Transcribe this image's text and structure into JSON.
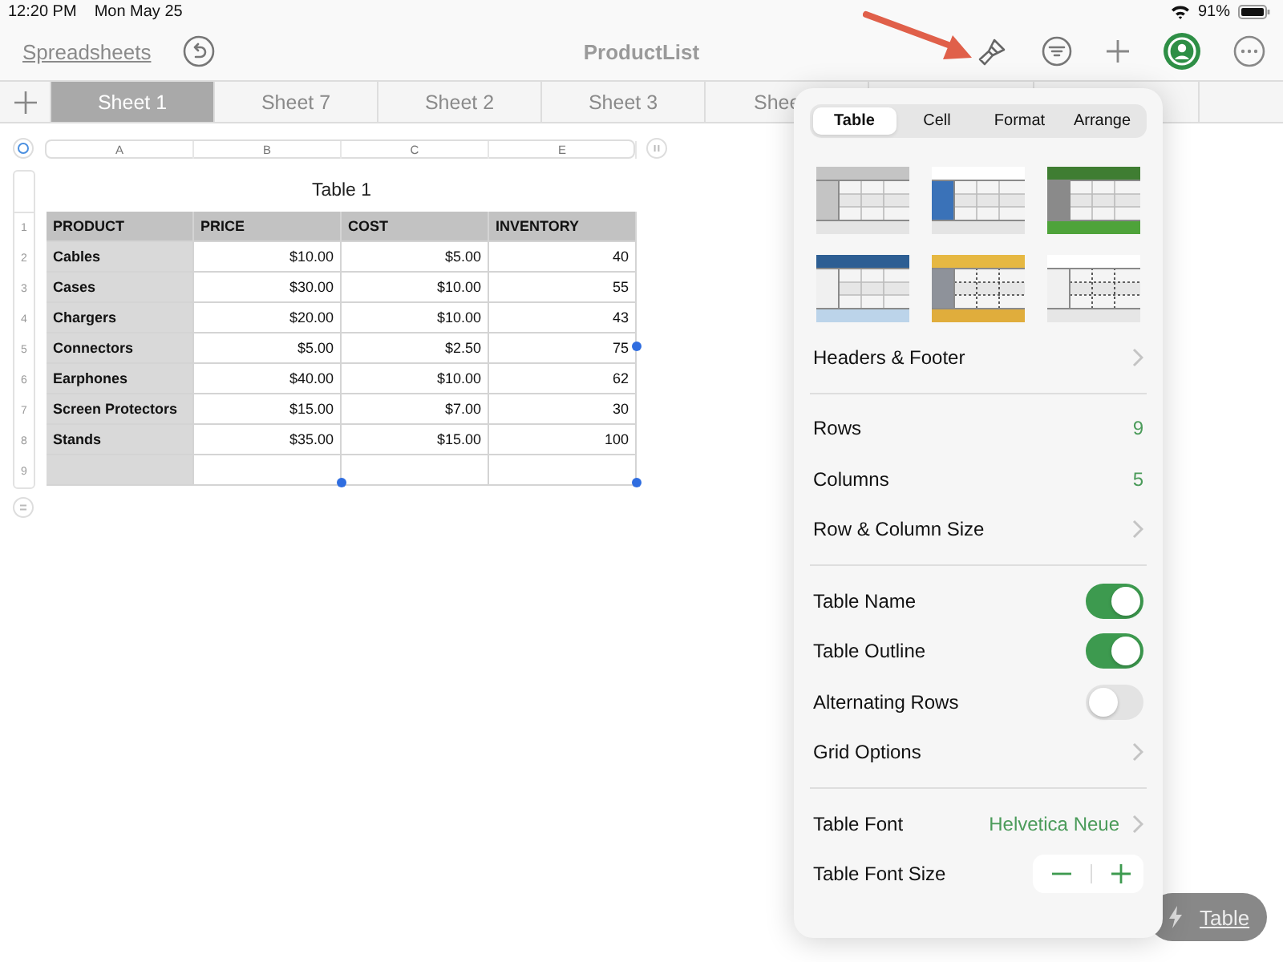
{
  "status_bar": {
    "time": "12:20 PM",
    "date": "Mon May 25",
    "battery": "91%"
  },
  "toolbar": {
    "back_link": "Spreadsheets",
    "title": "ProductList"
  },
  "sheet_tabs": [
    {
      "label": "Sheet 1",
      "selected": true
    },
    {
      "label": "Sheet 7",
      "selected": false
    },
    {
      "label": "Sheet 2",
      "selected": false
    },
    {
      "label": "Sheet 3",
      "selected": false
    },
    {
      "label": "Shee",
      "selected": false
    }
  ],
  "column_headers": [
    "A",
    "B",
    "C",
    "E"
  ],
  "table": {
    "title": "Table 1",
    "row_numbers": [
      "1",
      "2",
      "3",
      "4",
      "5",
      "6",
      "7",
      "8",
      "9"
    ],
    "columns": [
      "PRODUCT",
      "PRICE",
      "COST",
      "INVENTORY"
    ],
    "rows": [
      [
        "Cables",
        "$10.00",
        "$5.00",
        "40"
      ],
      [
        "Cases",
        "$30.00",
        "$10.00",
        "55"
      ],
      [
        "Chargers",
        "$20.00",
        "$10.00",
        "43"
      ],
      [
        "Connectors",
        "$5.00",
        "$2.50",
        "75"
      ],
      [
        "Earphones",
        "$40.00",
        "$10.00",
        "62"
      ],
      [
        "Screen Protectors",
        "$15.00",
        "$7.00",
        "30"
      ],
      [
        "Stands",
        "$35.00",
        "$15.00",
        "100"
      ],
      [
        "",
        "",
        "",
        ""
      ]
    ]
  },
  "popover": {
    "tabs": [
      {
        "label": "Table",
        "selected": true
      },
      {
        "label": "Cell",
        "selected": false
      },
      {
        "label": "Format",
        "selected": false
      },
      {
        "label": "Arrange",
        "selected": false
      }
    ],
    "sections": [
      [
        {
          "kind": "link",
          "label": "Headers & Footer"
        }
      ],
      [
        {
          "kind": "value",
          "label": "Rows",
          "value": "9"
        },
        {
          "kind": "value",
          "label": "Columns",
          "value": "5"
        },
        {
          "kind": "link",
          "label": "Row & Column Size"
        }
      ],
      [
        {
          "kind": "toggle",
          "label": "Table Name",
          "on": true
        },
        {
          "kind": "toggle",
          "label": "Table Outline",
          "on": true
        },
        {
          "kind": "toggle",
          "label": "Alternating Rows",
          "on": false
        },
        {
          "kind": "link",
          "label": "Grid Options"
        }
      ],
      [
        {
          "kind": "link",
          "label": "Table Font",
          "value": "Helvetica Neue"
        },
        {
          "kind": "stepper",
          "label": "Table Font Size"
        }
      ]
    ]
  },
  "quick_button": {
    "label": "Table"
  }
}
